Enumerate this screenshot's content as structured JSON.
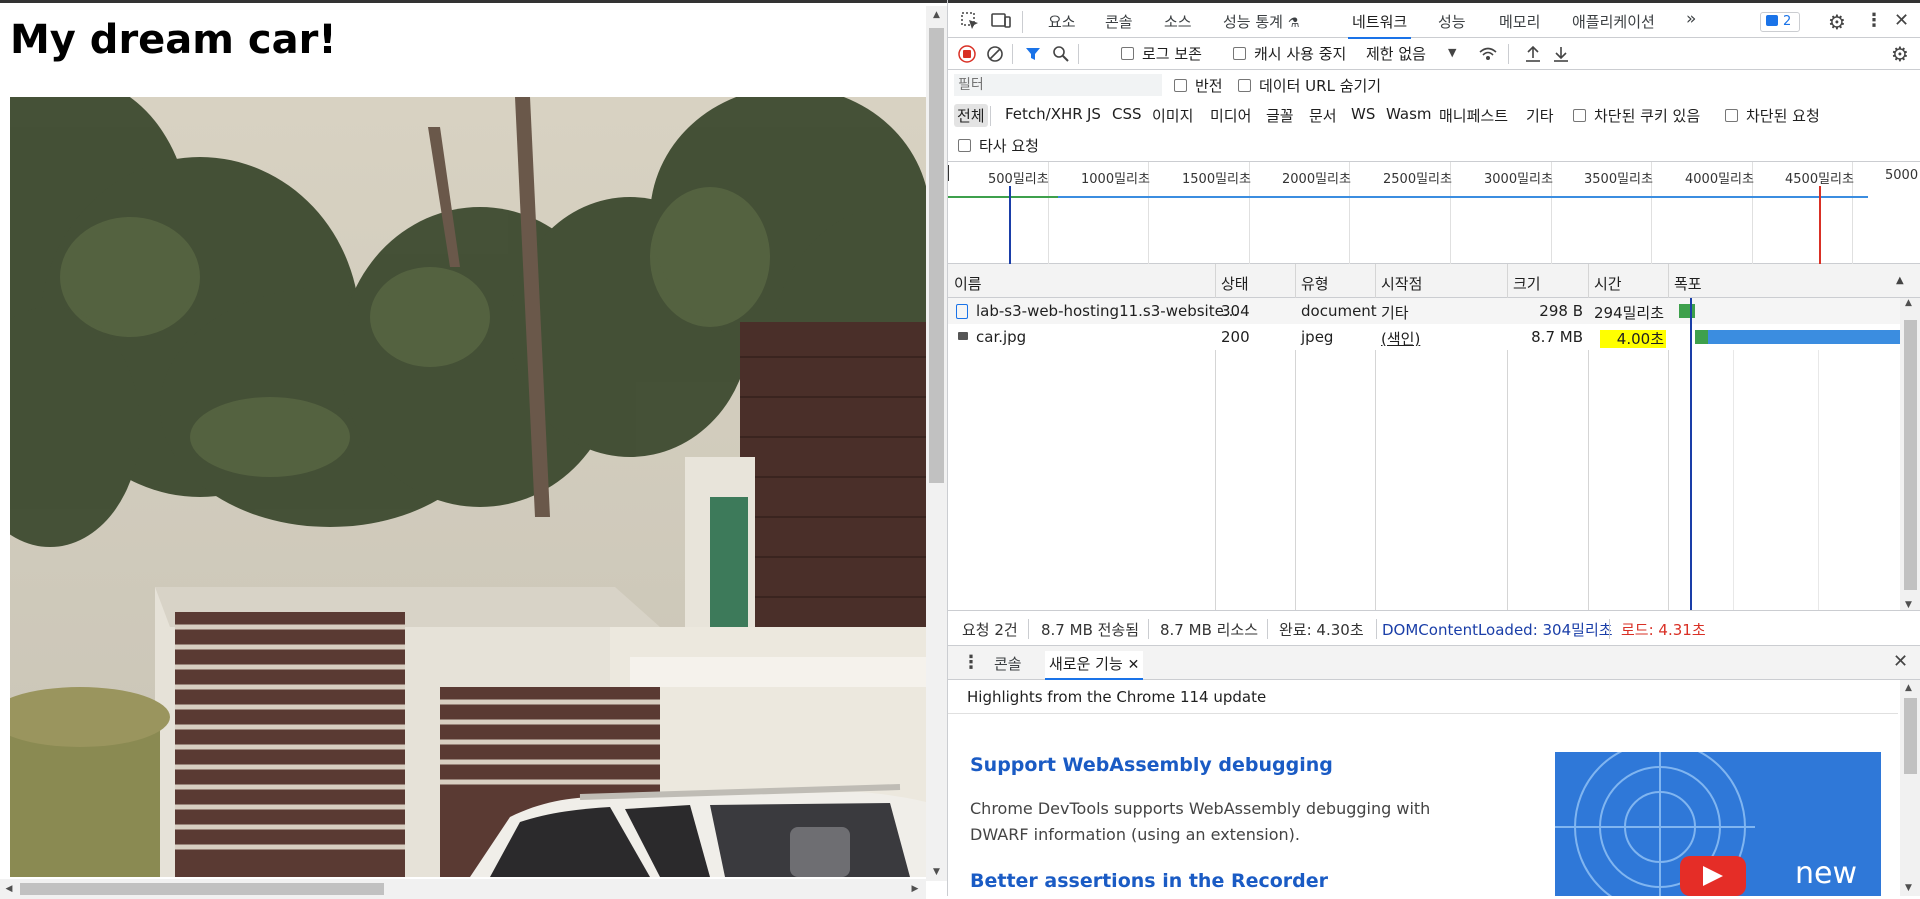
{
  "page": {
    "heading": "My dream car!"
  },
  "devtools": {
    "tabs": [
      "요소",
      "콘솔",
      "소스",
      "성능 통계",
      "네트워크",
      "성능",
      "메모리",
      "애플리케이션"
    ],
    "active_tab": "네트워크",
    "more_tabs": "»",
    "issues_count": "2",
    "toolbar": {
      "preserve_log": "로그 보존",
      "disable_cache": "캐시 사용 중지",
      "throttling": "제한 없음"
    },
    "filter": {
      "placeholder": "필터",
      "invert": "반전",
      "hide_data_urls": "데이터 URL 숨기기"
    },
    "type_filters": [
      "전체",
      "Fetch/XHR",
      "JS",
      "CSS",
      "이미지",
      "미디어",
      "글꼴",
      "문서",
      "WS",
      "Wasm",
      "매니페스트",
      "기타"
    ],
    "blocked_cookies": "차단된 쿠키 있음",
    "blocked_requests": "차단된 요청",
    "third_party": "타사 요청",
    "overview_ticks": [
      "500밀리초",
      "1000밀리초",
      "1500밀리초",
      "2000밀리초",
      "2500밀리초",
      "3000밀리초",
      "3500밀리초",
      "4000밀리초",
      "4500밀리초",
      "5000"
    ],
    "columns": [
      "이름",
      "상태",
      "유형",
      "시작점",
      "크기",
      "시간",
      "폭포"
    ],
    "requests": [
      {
        "name": "lab-s3-web-hosting11.s3-website...",
        "status": "304",
        "type": "document",
        "initiator": "기타",
        "size": "298 B",
        "time": "294밀리초",
        "kind": "document"
      },
      {
        "name": "car.jpg",
        "status": "200",
        "type": "jpeg",
        "initiator": "(색인)",
        "size": "8.7 MB",
        "time": "4.00초",
        "kind": "image"
      }
    ],
    "summary": {
      "requests": "요청 2건",
      "transferred": "8.7 MB 전송됨",
      "resources": "8.7 MB 리소스",
      "finish": "완료: 4.30초",
      "dcl": "DOMContentLoaded: 304밀리초",
      "load": "로드: 4.31초"
    },
    "drawer": {
      "tabs": [
        "콘솔",
        "새로운 기능"
      ],
      "active_tab": "새로운 기능",
      "header": "Highlights from the Chrome 114 update",
      "articles": [
        {
          "title": "Support WebAssembly debugging",
          "body": "Chrome DevTools supports WebAssembly debugging with DWARF information (using an extension)."
        },
        {
          "title": "Better assertions in the Recorder",
          "body": ""
        }
      ],
      "banner_text": "new"
    }
  },
  "colors": {
    "accent": "#1a73e8",
    "dcl_blue": "#1a3ea8",
    "load_red": "#d93025",
    "highlight_yellow": "#ffff00",
    "waterfall_green": "#3ea04c",
    "waterfall_blue": "#3b8de0"
  }
}
